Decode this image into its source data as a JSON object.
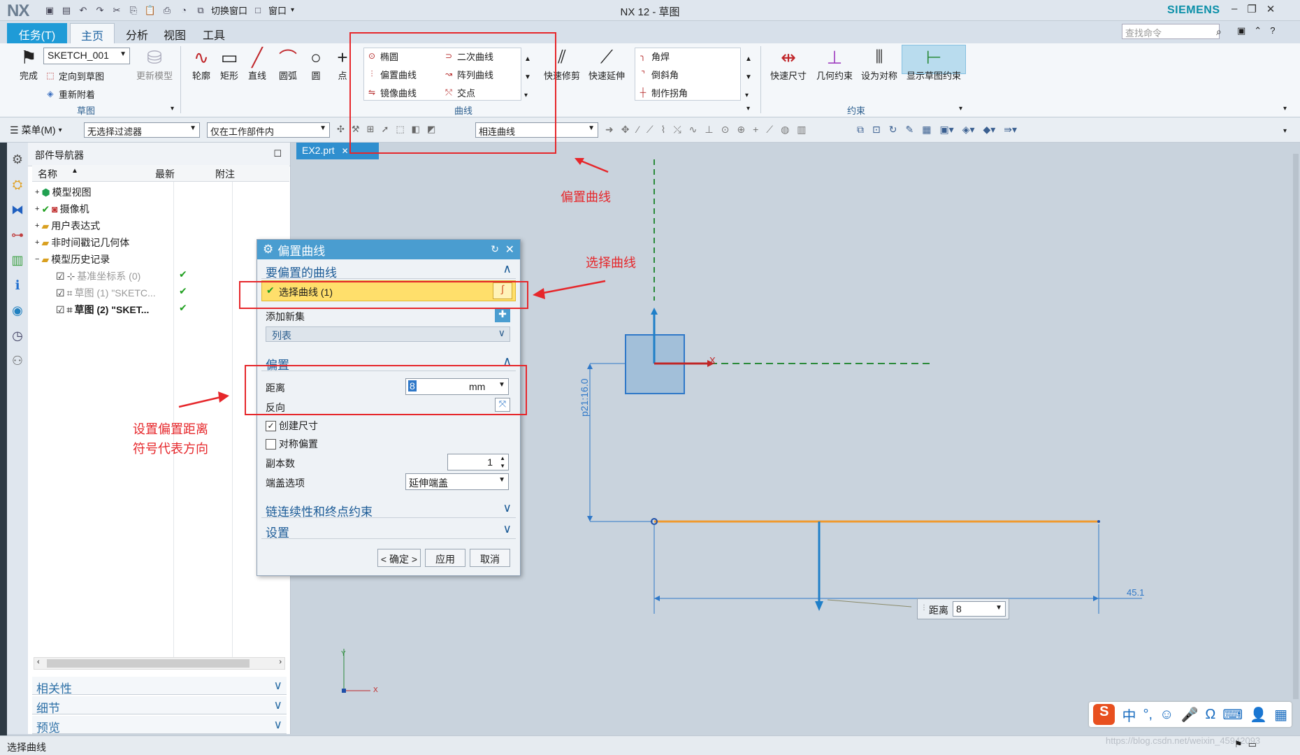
{
  "app": {
    "logo": "NX",
    "title": "NX 12 - 草图",
    "brand": "SIEMENS"
  },
  "quick_access": {
    "switch_window": "切换窗口",
    "window_menu": "窗口"
  },
  "tabs": [
    {
      "label": "任务(T)"
    },
    {
      "label": "主页"
    },
    {
      "label": "分析"
    },
    {
      "label": "视图"
    },
    {
      "label": "工具"
    }
  ],
  "search": {
    "placeholder": "查找命令"
  },
  "ribbon": {
    "sketch_group": {
      "finish": "完成",
      "sketch_name": "SKETCH_001",
      "orient": "定向到草图",
      "reattach": "重新附着",
      "update_model": "更新模型",
      "label": "草图"
    },
    "curve_group": {
      "profile": "轮廓",
      "rectangle": "矩形",
      "line": "直线",
      "arc": "圆弧",
      "circle": "圆",
      "point": "点",
      "ellipse": "椭圆",
      "conic": "二次曲线",
      "offset_curve": "偏置曲线",
      "pattern_curve": "阵列曲线",
      "mirror_curve": "镜像曲线",
      "intersection": "交点",
      "label": "曲线",
      "quick_trim": "快速修剪",
      "quick_extend": "快速延伸",
      "fillet": "角焊",
      "chamfer": "倒斜角",
      "make_corner": "制作拐角"
    },
    "constraint_group": {
      "rapid_dim": "快速尺寸",
      "geo_constraint": "几何约束",
      "make_symmetric": "设为对称",
      "show_constraints": "显示草图约束",
      "label": "约束"
    }
  },
  "toolbar2": {
    "menu": "菜单(M)",
    "filter": "无选择过滤器",
    "scope": "仅在工作部件内",
    "curve_rule": "相连曲线"
  },
  "navigator": {
    "title": "部件导航器",
    "col_name": "名称",
    "col_latest": "最新",
    "col_note": "附注",
    "items": [
      {
        "label": "模型视图"
      },
      {
        "label": "摄像机"
      },
      {
        "label": "用户表达式"
      },
      {
        "label": "非时间戳记几何体"
      },
      {
        "label": "模型历史记录"
      },
      {
        "label": "基准坐标系 (0)"
      },
      {
        "label": "草图 (1) \"SKETC..."
      },
      {
        "label": "草图 (2) \"SKET..."
      }
    ],
    "sections": [
      "相关性",
      "细节",
      "预览"
    ]
  },
  "doc_tab": {
    "label": "EX2.prt"
  },
  "dialog": {
    "title": "偏置曲线",
    "sec_curves": "要偏置的曲线",
    "select_curve": "选择曲线 (1)",
    "add_set": "添加新集",
    "list": "列表",
    "sec_offset": "偏置",
    "distance_label": "距离",
    "distance_value": "8",
    "unit": "mm",
    "reverse_label": "反向",
    "create_dim": "创建尺寸",
    "symmetric": "对称偏置",
    "copies_label": "副本数",
    "copies_value": "1",
    "cap_label": "端盖选项",
    "cap_value": "延伸端盖",
    "sec_chain": "链连续性和终点约束",
    "sec_settings": "设置",
    "ok": "< 确定 >",
    "apply": "应用",
    "cancel": "取消"
  },
  "canvas": {
    "dim_vertical": "p21:16.0",
    "dim_horizontal": "45.1",
    "onscreen_label": "距离",
    "onscreen_value": "8",
    "axis_x": "X",
    "axis_y": "Y"
  },
  "annotations": {
    "offset_curve": "偏置曲线",
    "select_curve": "选择曲线",
    "set_distance_1": "设置偏置距离",
    "set_distance_2": "符号代表方向"
  },
  "ime": {
    "chinese": "中"
  },
  "status": {
    "text": "选择曲线"
  },
  "watermark": "https://blog.csdn.net/weixin_45942093",
  "colors": {
    "accent": "#1f9bd7",
    "annotation": "#e6272b",
    "highlight": "#ffdf6b",
    "curve": "#f09a2e"
  }
}
